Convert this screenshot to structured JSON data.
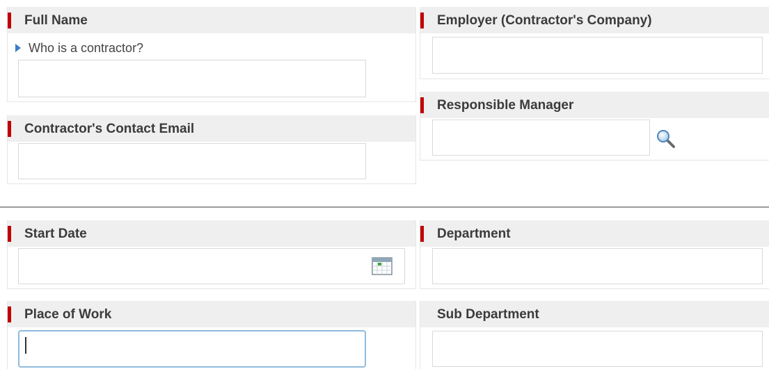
{
  "form": {
    "full_name": {
      "label": "Full Name",
      "help_link": "Who is a contractor?",
      "value": ""
    },
    "employer": {
      "label": "Employer (Contractor's Company)",
      "value": ""
    },
    "contact_email": {
      "label": "Contractor's Contact Email",
      "value": ""
    },
    "responsible_manager": {
      "label": "Responsible Manager",
      "value": "",
      "icon": "magnifier-icon"
    },
    "start_date": {
      "label": "Start Date",
      "value": "",
      "icon": "calendar-icon"
    },
    "department": {
      "label": "Department",
      "value": ""
    },
    "place_of_work": {
      "label": "Place of Work",
      "value": "",
      "focused": true
    },
    "sub_department": {
      "label": "Sub Department",
      "value": ""
    }
  },
  "colors": {
    "required_marker": "#c00000",
    "header_bg": "#efefef",
    "help_arrow": "#3a7dc4",
    "focus_border": "#8fbbe0"
  }
}
